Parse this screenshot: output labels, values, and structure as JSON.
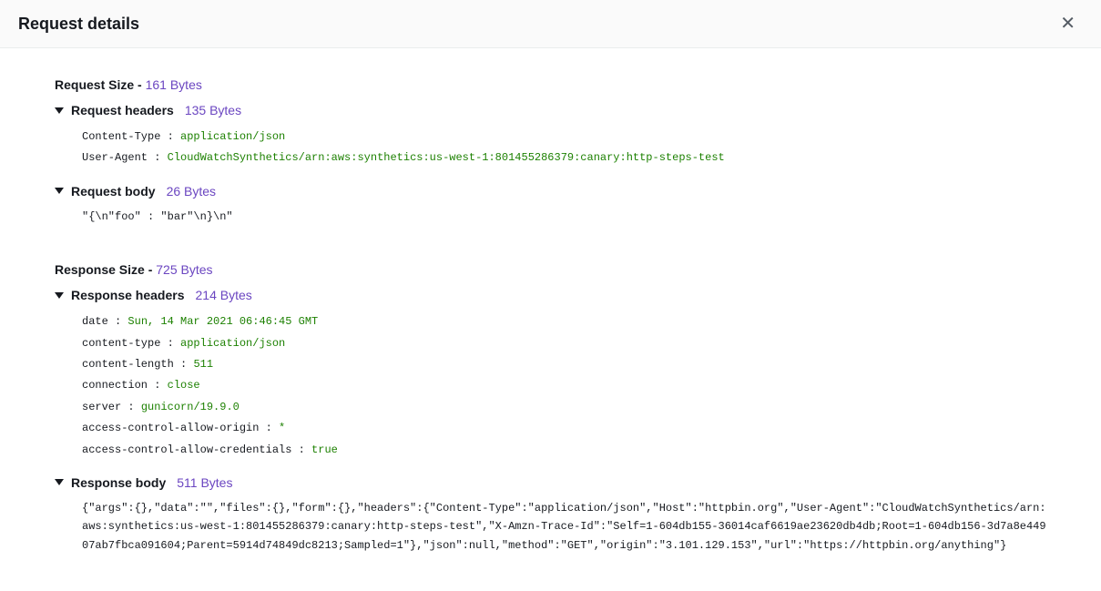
{
  "header": {
    "title": "Request details"
  },
  "request": {
    "sizeLabel": "Request Size - ",
    "sizeValue": "161 Bytes",
    "headers": {
      "title": "Request headers",
      "size": "135 Bytes",
      "items": [
        {
          "key": "Content-Type",
          "value": "application/json"
        },
        {
          "key": "User-Agent",
          "value": "CloudWatchSynthetics/arn:aws:synthetics:us-west-1:801455286379:canary:http-steps-test"
        }
      ]
    },
    "body": {
      "title": "Request body",
      "size": "26 Bytes",
      "content": "\"{\\n\"foo\" : \"bar\"\\n}\\n\""
    }
  },
  "response": {
    "sizeLabel": "Response Size - ",
    "sizeValue": "725 Bytes",
    "headers": {
      "title": "Response headers",
      "size": "214 Bytes",
      "items": [
        {
          "key": "date",
          "value": "Sun, 14 Mar 2021 06:46:45 GMT"
        },
        {
          "key": "content-type",
          "value": "application/json"
        },
        {
          "key": "content-length",
          "value": "511"
        },
        {
          "key": "connection",
          "value": "close"
        },
        {
          "key": "server",
          "value": "gunicorn/19.9.0"
        },
        {
          "key": "access-control-allow-origin",
          "value": "*"
        },
        {
          "key": "access-control-allow-credentials",
          "value": "true"
        }
      ]
    },
    "body": {
      "title": "Response body",
      "size": "511 Bytes",
      "content": "{\"args\":{},\"data\":\"\",\"files\":{},\"form\":{},\"headers\":{\"Content-Type\":\"application/json\",\"Host\":\"httpbin.org\",\"User-Agent\":\"CloudWatchSynthetics/arn:aws:synthetics:us-west-1:801455286379:canary:http-steps-test\",\"X-Amzn-Trace-Id\":\"Self=1-604db155-36014caf6619ae23620db4db;Root=1-604db156-3d7a8e44907ab7fbca091604;Parent=5914d74849dc8213;Sampled=1\"},\"json\":null,\"method\":\"GET\",\"origin\":\"3.101.129.153\",\"url\":\"https://httpbin.org/anything\"}"
    }
  }
}
